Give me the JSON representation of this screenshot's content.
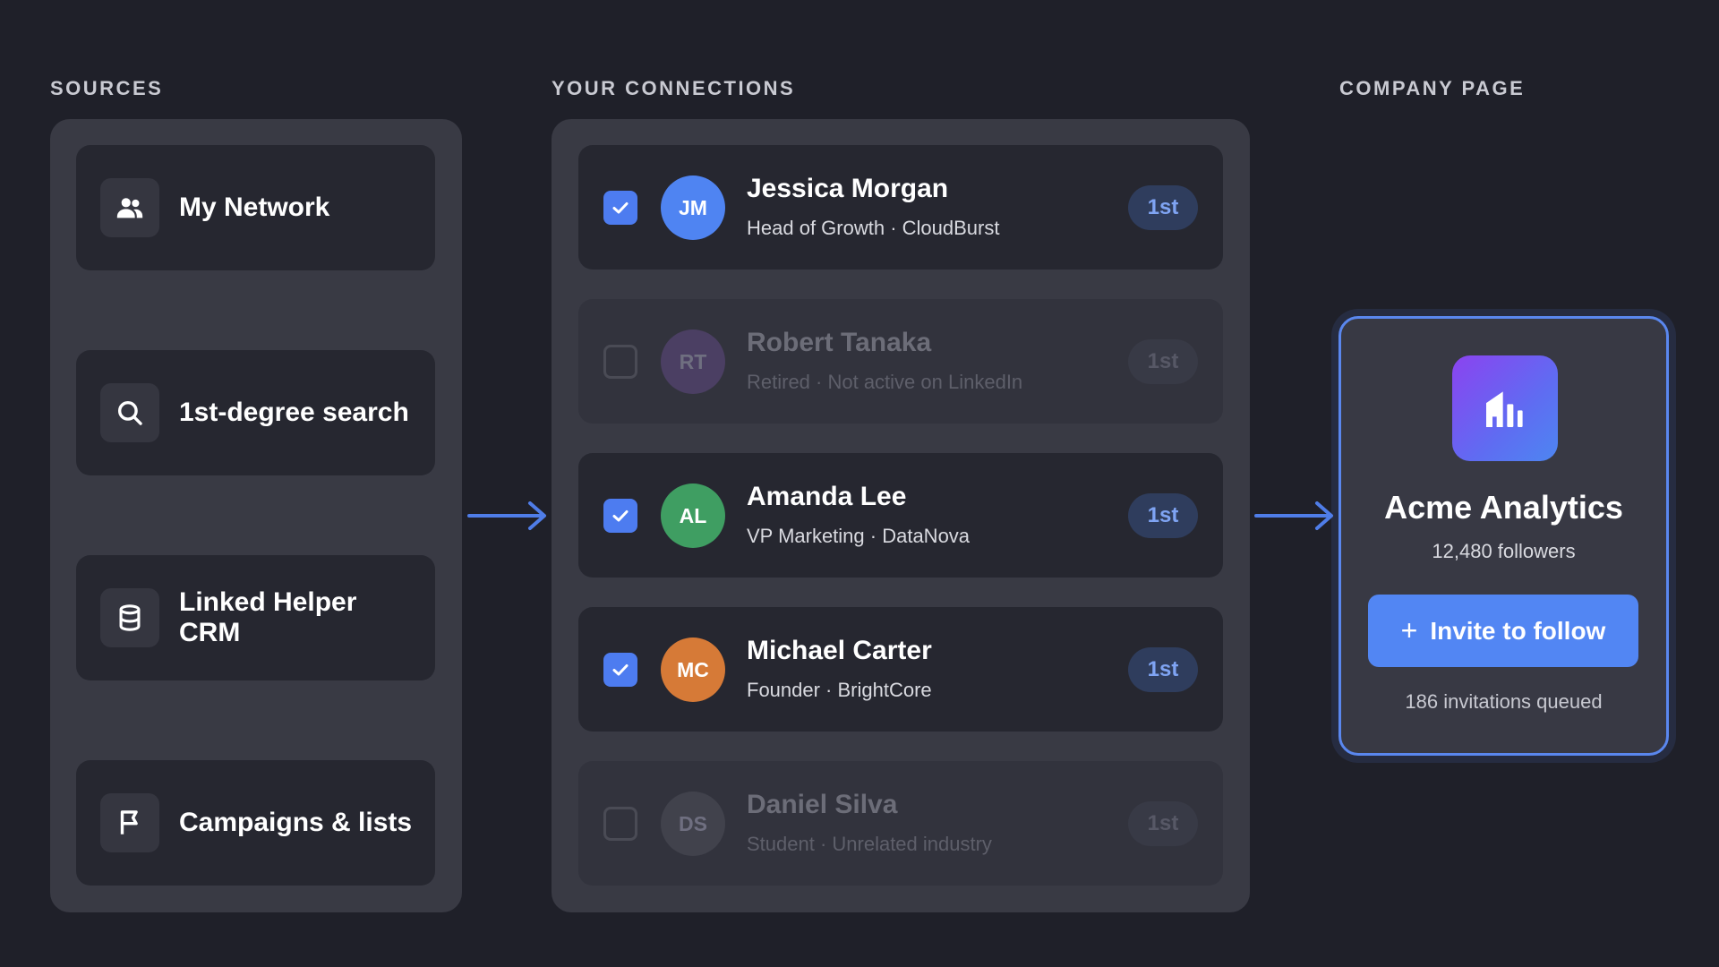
{
  "sections": {
    "sources_title": "SOURCES",
    "connections_title": "YOUR CONNECTIONS",
    "company_title": "COMPANY PAGE"
  },
  "sources": [
    {
      "label": "My Network",
      "icon": "people-icon"
    },
    {
      "label": "1st-degree search",
      "icon": "search-icon"
    },
    {
      "label": "Linked Helper CRM",
      "icon": "database-icon"
    },
    {
      "label": "Campaigns & lists",
      "icon": "flag-icon"
    }
  ],
  "connections": [
    {
      "initials": "JM",
      "name": "Jessica Morgan",
      "subtitle": "Head of Growth · CloudBurst",
      "degree": "1st",
      "selected": true,
      "avatar_color": "#4f84f2"
    },
    {
      "initials": "RT",
      "name": "Robert Tanaka",
      "subtitle": "Retired · Not active on LinkedIn",
      "degree": "1st",
      "selected": false,
      "avatar_color": "#4b3f63"
    },
    {
      "initials": "AL",
      "name": "Amanda Lee",
      "subtitle": "VP Marketing · DataNova",
      "degree": "1st",
      "selected": true,
      "avatar_color": "#3f9e62"
    },
    {
      "initials": "MC",
      "name": "Michael Carter",
      "subtitle": "Founder · BrightCore",
      "degree": "1st",
      "selected": true,
      "avatar_color": "#d67a37"
    },
    {
      "initials": "DS",
      "name": "Daniel Silva",
      "subtitle": "Student · Unrelated industry",
      "degree": "1st",
      "selected": false,
      "avatar_color": "#41424c"
    }
  ],
  "company": {
    "name": "Acme Analytics",
    "followers": "12,480 followers",
    "invite_label": "Invite to follow",
    "queued": "186 invitations queued",
    "logo_icon": "building-icon"
  },
  "colors": {
    "accent": "#5286f3",
    "background": "#1f2029"
  }
}
